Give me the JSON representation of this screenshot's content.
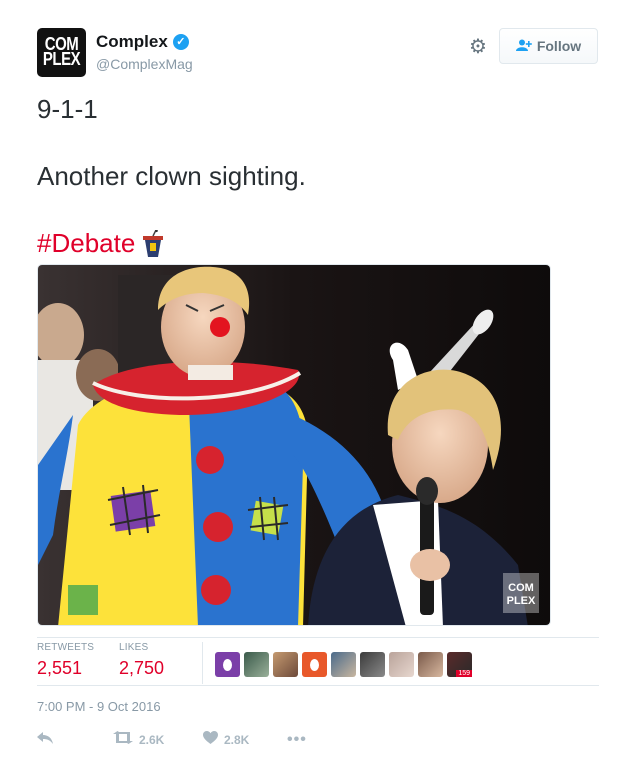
{
  "author": {
    "avatar_text_line1": "COM",
    "avatar_text_line2": "PLEX",
    "display_name": "Complex",
    "handle": "@ComplexMag",
    "verified_icon": "verified-badge-icon"
  },
  "follow_button": {
    "label": "Follow",
    "icon": "add-user-icon"
  },
  "tweet": {
    "line1": "9-1-1",
    "line2": "Another clown sighting.",
    "hashtag": "#Debate",
    "hashtag_emoji": "podium-icon"
  },
  "media": {
    "watermark_line1": "COM",
    "watermark_line2": "PLEX"
  },
  "stats": {
    "retweets_label": "RETWEETS",
    "retweets_value": "2,551",
    "likes_label": "LIKES",
    "likes_value": "2,750",
    "liker_badge": "159"
  },
  "timestamp": "7:00 PM - 9 Oct 2016",
  "actions": {
    "reply_icon": "reply-icon",
    "retweet_count": "2.6K",
    "like_count": "2.8K",
    "more_icon": "more-icon"
  },
  "colors": {
    "accent_red": "#e0002a",
    "twitter_blue": "#1da1f2",
    "muted": "#8899a6"
  }
}
